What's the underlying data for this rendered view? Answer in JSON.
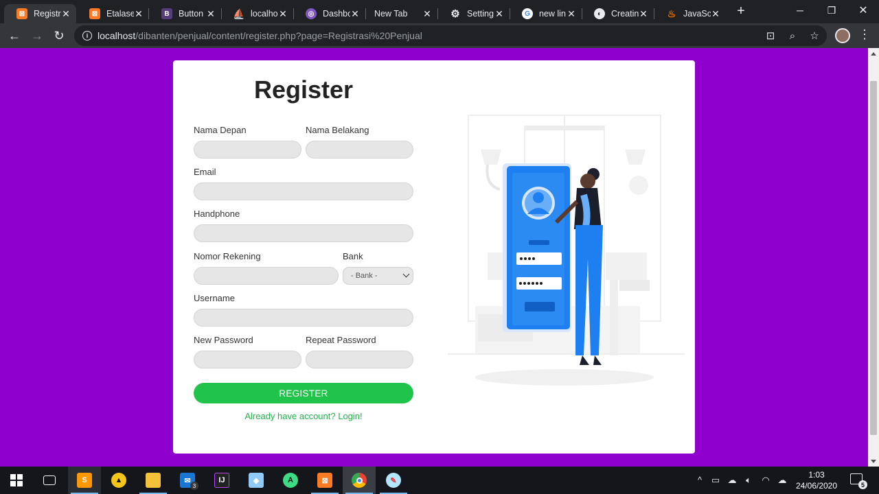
{
  "browser": {
    "tabs": [
      {
        "title": "Registra",
        "icon": "xampp-icon",
        "color": "#fb7a24",
        "active": true
      },
      {
        "title": "Etalase",
        "icon": "xampp-icon",
        "color": "#fb7a24"
      },
      {
        "title": "Button",
        "icon": "bootstrap-icon",
        "color": "#563d7c"
      },
      {
        "title": "localho",
        "icon": "phpmyadmin-icon",
        "color": "#f89c0e"
      },
      {
        "title": "Dashbo",
        "icon": "dashboard-icon",
        "color": "#7e57c2"
      },
      {
        "title": "New Tab",
        "icon": "",
        "color": ""
      },
      {
        "title": "Setting",
        "icon": "gear-icon",
        "color": "#e8eaed"
      },
      {
        "title": "new lin",
        "icon": "google-icon",
        "color": "#ffffff"
      },
      {
        "title": "Creatin",
        "icon": "globe-icon",
        "color": "#e8eaed"
      },
      {
        "title": "JavaScr",
        "icon": "java-icon",
        "color": "#e76f00"
      }
    ],
    "url_host": "localhost",
    "url_path": "/dibanten/penjual/content/register.php?page=Registrasi%20Penjual"
  },
  "page": {
    "background": "#8f00cf",
    "title": "Register",
    "labels": {
      "first_name": "Nama Depan",
      "last_name": "Nama Belakang",
      "email": "Email",
      "phone": "Handphone",
      "account_number": "Nomor Rekening",
      "bank": "Bank",
      "username": "Username",
      "new_password": "New Password",
      "repeat_password": "Repeat Password"
    },
    "bank_selected": "- Bank -",
    "register_button": "REGISTER",
    "login_link": "Already have account? Login!",
    "accent": "#21c44a"
  },
  "taskbar": {
    "mail_badge": "3",
    "time": "1:03",
    "date": "24/06/2020",
    "notifications": "5"
  }
}
